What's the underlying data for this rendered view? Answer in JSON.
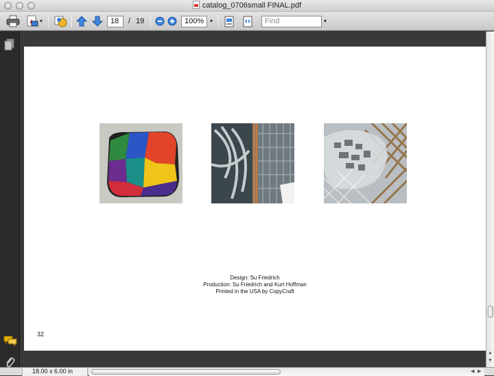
{
  "window": {
    "title": "catalog_0706small FINAL.pdf"
  },
  "toolbar": {
    "current_page": "18",
    "page_separator": "/",
    "total_pages": "19",
    "zoom": "100%",
    "find_placeholder": "Find"
  },
  "document": {
    "credits": [
      "Design: Su Friedrich",
      "Production: Su Friedrich and Kurt Hoffman",
      "Printed in the USA by CopyCraft"
    ],
    "page_number": "32",
    "thumbnails": [
      "artwork-color-patchwork",
      "artwork-gray-brushstrokes",
      "artwork-gray-pattern-collage"
    ]
  },
  "status": {
    "page_size": "18.00 x 6.00 in"
  },
  "icons": {
    "toolbar": [
      "print-icon",
      "create-pdf-icon",
      "share-icon",
      "page-up-icon",
      "page-down-icon",
      "zoom-out-icon",
      "zoom-in-icon",
      "fit-page-icon",
      "fit-width-icon"
    ],
    "sidebar": [
      "pages-icon",
      "comments-icon",
      "attachments-icon"
    ]
  },
  "colors": {
    "accent_blue": "#2f6fd0",
    "panel_dark": "#2b2b2b"
  }
}
